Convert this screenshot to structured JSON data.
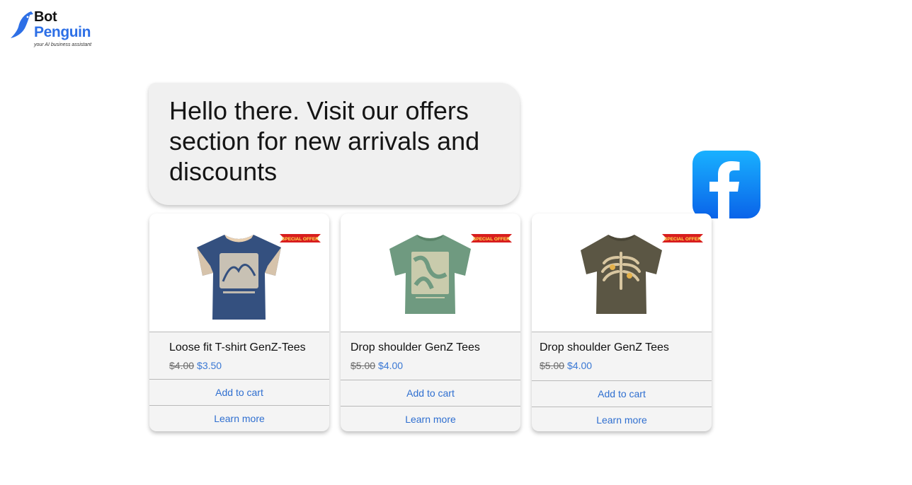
{
  "brand": {
    "name_line1": "Bot",
    "name_line2": "Penguin",
    "tagline": "your AI business assistant",
    "accent_color": "#2d6fe6",
    "icon": "penguin-bird-logo"
  },
  "message": {
    "text": "Hello there. Visit our offers section for new arrivals and discounts"
  },
  "channel": {
    "icon": "facebook-icon",
    "color": "#1877f2"
  },
  "badge": {
    "text": "SPECIAL OFFER",
    "color": "#d81e1e"
  },
  "products": [
    {
      "title": "Loose fit T-shirt GenZ-Tees",
      "old_price": "$4.00",
      "new_price": "$3.50",
      "add_to_cart": "Add to cart",
      "learn_more": "Learn more",
      "shirt_color": "#34507f"
    },
    {
      "title": "Drop shoulder GenZ Tees",
      "old_price": "$5.00",
      "new_price": "$4.00",
      "add_to_cart": "Add to cart",
      "learn_more": "Learn more",
      "shirt_color": "#6f9a80"
    },
    {
      "title": "Drop shoulder GenZ Tees",
      "old_price": "$5.00",
      "new_price": "$4.00",
      "add_to_cart": "Add to cart",
      "learn_more": "Learn more",
      "shirt_color": "#5b5644"
    }
  ]
}
